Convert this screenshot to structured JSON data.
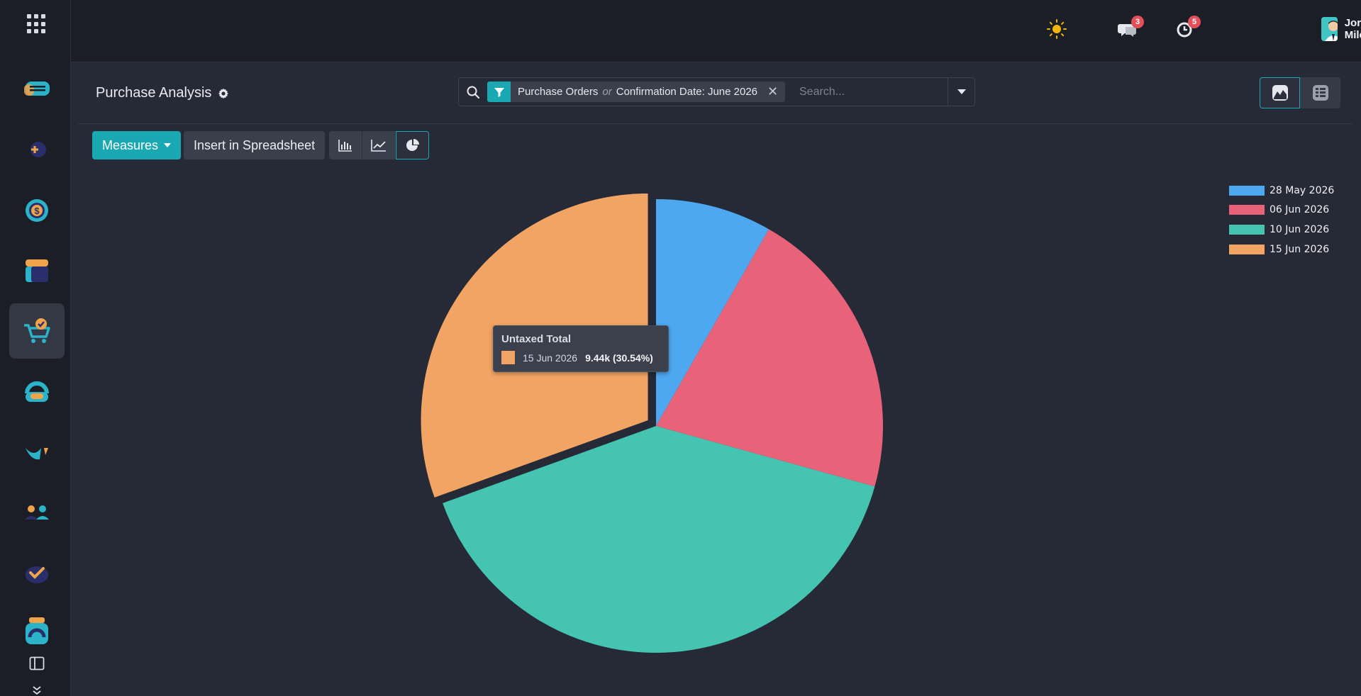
{
  "sidebar": {
    "apps_menu_icon": "grid-icon",
    "items": [
      {
        "name": "discuss-app",
        "icon": "chat-bubble-icon"
      },
      {
        "name": "crm-app",
        "icon": "plus-circle-icon"
      },
      {
        "name": "sales-app",
        "icon": "dollar-icon"
      },
      {
        "name": "inventory-app",
        "icon": "box-icon"
      },
      {
        "name": "purchase-app",
        "icon": "cart-check-icon",
        "active": true
      },
      {
        "name": "helpdesk-app",
        "icon": "headset-icon"
      },
      {
        "name": "knowledge-app",
        "icon": "ribbon-icon"
      },
      {
        "name": "employees-app",
        "icon": "people-icon"
      },
      {
        "name": "project-app",
        "icon": "check-icon"
      },
      {
        "name": "support-app",
        "icon": "phone-icon"
      }
    ]
  },
  "topbar": {
    "theme_icon": "sun-icon",
    "messages_badge": "3",
    "activities_badge": "5",
    "user_name": "Jordan Miles"
  },
  "control_panel": {
    "title": "Purchase Analysis",
    "facet": {
      "part1": "Purchase Orders",
      "or": "or",
      "part2": "Confirmation Date: June 2026"
    },
    "search_placeholder": "Search...",
    "measures_label": "Measures",
    "insert_label": "Insert in Spreadsheet"
  },
  "chart_data": {
    "type": "pie",
    "categories": [
      "28 May 2026",
      "06 Jun 2026",
      "10 Jun 2026",
      "15 Jun 2026"
    ],
    "values": [
      2.56,
      6.5,
      12.42,
      9.44
    ],
    "percentages": [
      8.3,
      21.0,
      40.2,
      30.54
    ],
    "colors": [
      "#4ea8f0",
      "#e8637a",
      "#45c5b1",
      "#f2a464"
    ],
    "legend_position": "top-right",
    "measure": "Untaxed Total",
    "highlighted_index": 3
  },
  "tooltip": {
    "title": "Untaxed Total",
    "label": "15 Jun 2026",
    "value": "9.44k (30.54%)"
  }
}
